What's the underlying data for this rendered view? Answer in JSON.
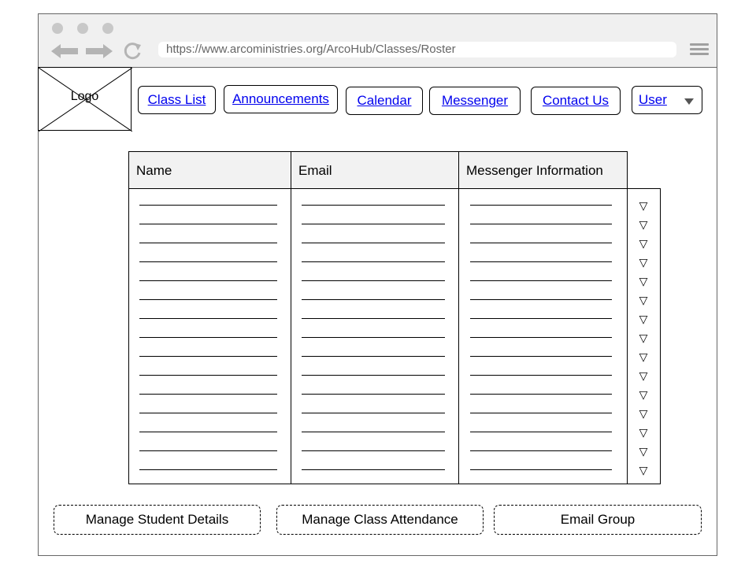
{
  "browser": {
    "url": "https://www.arcoministries.org/ArcoHub/Classes/Roster"
  },
  "logo": {
    "label": "Logo"
  },
  "nav": {
    "class_list": "Class List",
    "announcements": "Announcements",
    "calendar": "Calendar",
    "messenger": "Messenger",
    "contact_us": "Contact Us",
    "user": "User"
  },
  "table": {
    "headers": [
      "Name",
      "Email",
      "Messenger Information"
    ],
    "row_count": 15
  },
  "actions": {
    "manage_student": "Manage Student Details",
    "manage_attendance": "Manage Class Attendance",
    "email_group": "Email Group"
  }
}
